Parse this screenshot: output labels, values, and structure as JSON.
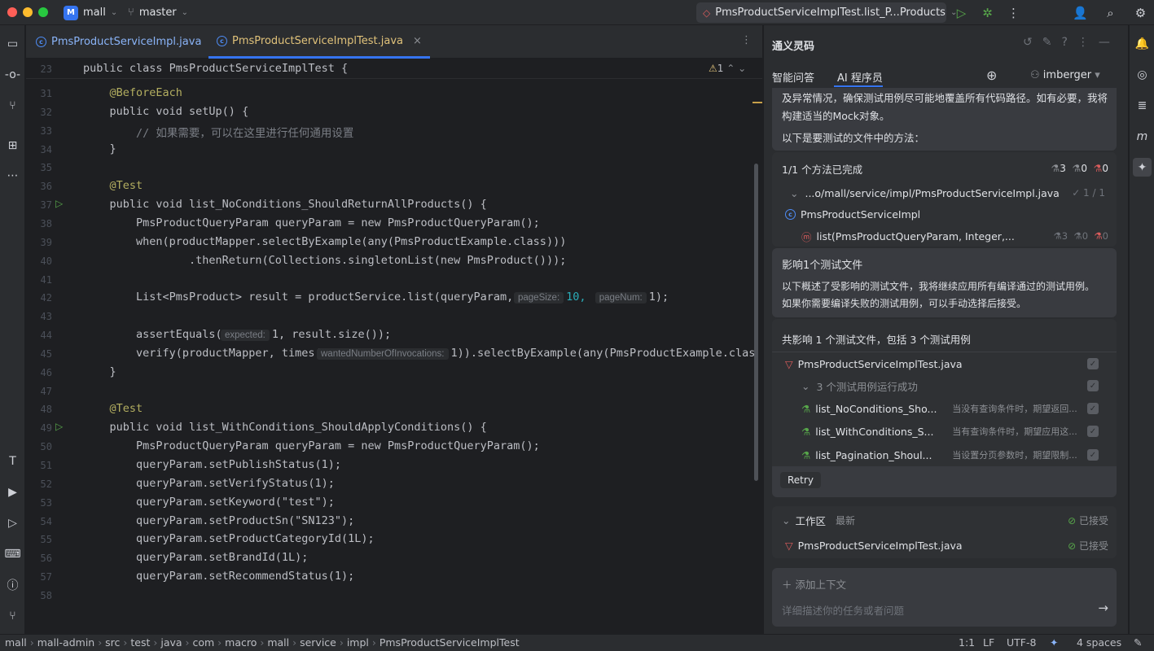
{
  "titlebar": {
    "project_badge": "M",
    "project": "mall",
    "branch": "master",
    "run_config": "PmsProductServiceImplTest.list_P...Products"
  },
  "tabs": [
    {
      "label": "PmsProductServiceImpl.java"
    },
    {
      "label": "PmsProductServiceImplTest.java"
    }
  ],
  "editor": {
    "sticky_num": "23",
    "sticky_code": "public class PmsProductServiceImplTest {",
    "warn_count": "1",
    "lines": [
      {
        "n": "31",
        "code": "    @BeforeEach"
      },
      {
        "n": "32",
        "code": "    public void setUp() {"
      },
      {
        "n": "33",
        "code": "        // 如果需要，可以在这里进行任何通用设置"
      },
      {
        "n": "34",
        "code": "    }"
      },
      {
        "n": "35",
        "code": ""
      },
      {
        "n": "36",
        "code": "    @Test"
      },
      {
        "n": "37",
        "code": "    public void list_NoConditions_ShouldReturnAllProducts() {"
      },
      {
        "n": "38",
        "code": "        PmsProductQueryParam queryParam = new PmsProductQueryParam();"
      },
      {
        "n": "39",
        "code": "        when(productMapper.selectByExample(any(PmsProductExample.class)))"
      },
      {
        "n": "40",
        "code": "                .thenReturn(Collections.singletonList(new PmsProduct()));"
      },
      {
        "n": "41",
        "code": ""
      },
      {
        "n": "42",
        "code": "        List<PmsProduct> result = productService.list(queryParam, "
      },
      {
        "n": "43",
        "code": ""
      },
      {
        "n": "44",
        "code": "        assertEquals("
      },
      {
        "n": "45",
        "code": "        verify(productMapper, times("
      },
      {
        "n": "46",
        "code": "    }"
      },
      {
        "n": "47",
        "code": ""
      },
      {
        "n": "48",
        "code": "    @Test"
      },
      {
        "n": "49",
        "code": "    public void list_WithConditions_ShouldApplyConditions() {"
      },
      {
        "n": "50",
        "code": "        PmsProductQueryParam queryParam = new PmsProductQueryParam();"
      },
      {
        "n": "51",
        "code": "        queryParam.setPublishStatus(1);"
      },
      {
        "n": "52",
        "code": "        queryParam.setVerifyStatus(1);"
      },
      {
        "n": "53",
        "code": "        queryParam.setKeyword(\"test\");"
      },
      {
        "n": "54",
        "code": "        queryParam.setProductSn(\"SN123\");"
      },
      {
        "n": "55",
        "code": "        queryParam.setProductCategoryId(1L);"
      },
      {
        "n": "56",
        "code": "        queryParam.setBrandId(1L);"
      },
      {
        "n": "57",
        "code": "        queryParam.setRecommendStatus(1);"
      },
      {
        "n": "58",
        "code": ""
      }
    ],
    "hints": {
      "pageSize": "pageSize:",
      "pageSizeVal": "10,",
      "pageNum": "pageNum:",
      "pageNumVal": "1);",
      "expected": "expected:",
      "expectedRest": "1, result.size());",
      "wanted": "wantedNumberOfInvocations:",
      "wantedRest": "1)).selectByExample(any(PmsProductExample.clas"
    }
  },
  "panel": {
    "title": "通义灵码",
    "tab_qa": "智能问答",
    "tab_ai": "AI 程序员",
    "user": "imberger",
    "intro1": "及异常情况，确保测试用例尽可能地覆盖所有代码路径。如有必要，我将",
    "intro2": "构建适当的Mock对象。",
    "intro3": "以下是要测试的文件中的方法：",
    "progress": "1/1 个方法已完成",
    "c_pass": "3",
    "c_warn": "0",
    "c_fail": "0",
    "path": "...o/mall/service/impl/PmsProductServiceImpl.java",
    "path_done": "✓ 1 / 1",
    "class_name": "PmsProductServiceImpl",
    "method": "list(PmsProductQueryParam, Integer,...",
    "m_pass": "3",
    "m_warn": "0",
    "m_fail": "0",
    "impact_title": "影响1个测试文件",
    "impact1": "以下概述了受影响的测试文件，我将继续应用所有编译通过的测试用例。",
    "impact2": "如果你需要编译失败的测试用例，可以手动选择后接受。",
    "summary": "共影响 1 个测试文件，包括 3 个测试用例",
    "test_file": "PmsProductServiceImplTest.java",
    "run_ok": "3 个测试用例运行成功",
    "cases": [
      {
        "name": "list_NoConditions_Sho...",
        "desc": "当没有查询条件时，期望返回..."
      },
      {
        "name": "list_WithConditions_S...",
        "desc": "当有查询条件时，期望应用这..."
      },
      {
        "name": "list_Pagination_Shoul...",
        "desc": "当设置分页参数时，期望限制..."
      }
    ],
    "retry": "Retry",
    "workspace": "工作区",
    "latest": "最新",
    "accepted": "已接受",
    "ws_file": "PmsProductServiceImplTest.java",
    "ws_accepted": "已接受",
    "add_context": "添加上下文",
    "placeholder": "详细描述你的任务或者问题"
  },
  "statusbar": {
    "crumbs": [
      "mall",
      "mall-admin",
      "src",
      "test",
      "java",
      "com",
      "macro",
      "mall",
      "service",
      "impl",
      "PmsProductServiceImplTest"
    ],
    "pos": "1:1",
    "le": "LF",
    "enc": "UTF-8",
    "indent": "4 spaces"
  }
}
